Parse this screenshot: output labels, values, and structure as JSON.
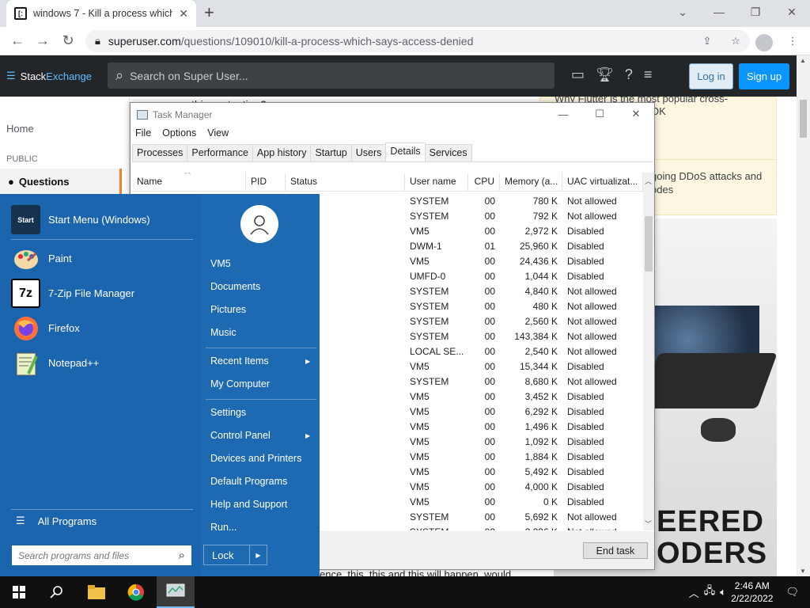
{
  "browser": {
    "tab_title": "windows 7 - Kill a process which",
    "url_host": "superuser.com",
    "url_path": "/questions/109010/kill-a-process-which-says-access-denied"
  },
  "se": {
    "logo_a": "Stack",
    "logo_b": "Exchange",
    "search_placeholder": "Search on Super User...",
    "login": "Log in",
    "signup": "Sign up",
    "nav_home": "Home",
    "nav_public": "PUBLIC",
    "nav_questions": "Questions",
    "text_top": "this protection?",
    "text_bottom": "ence, this, this and this will happen, would",
    "sidebar_r1": "Why Flutter is the most popular cross-",
    "sidebar_r2": "OK",
    "sidebar_r3": "going DDoS attacks and\nodes",
    "ad_line1": "EERED",
    "ad_line2": "ODERS"
  },
  "taskmanager": {
    "title": "Task Manager",
    "menu": [
      "File",
      "Options",
      "View"
    ],
    "tabs": [
      "Processes",
      "Performance",
      "App history",
      "Startup",
      "Users",
      "Details",
      "Services"
    ],
    "active_tab": "Details",
    "columns": [
      "Name",
      "PID",
      "Status",
      "User name",
      "CPU",
      "Memory (a...",
      "UAC virtualizat..."
    ],
    "rows": [
      {
        "status": "g",
        "user": "SYSTEM",
        "cpu": "00",
        "mem": "780 K",
        "uac": "Not allowed"
      },
      {
        "status": "g",
        "user": "SYSTEM",
        "cpu": "00",
        "mem": "792 K",
        "uac": "Not allowed"
      },
      {
        "status": "g",
        "user": "VM5",
        "cpu": "00",
        "mem": "2,972 K",
        "uac": "Disabled"
      },
      {
        "status": "g",
        "user": "DWM-1",
        "cpu": "01",
        "mem": "25,960 K",
        "uac": "Disabled"
      },
      {
        "status": "g",
        "user": "VM5",
        "cpu": "00",
        "mem": "24,436 K",
        "uac": "Disabled"
      },
      {
        "status": "g",
        "user": "UMFD-0",
        "cpu": "00",
        "mem": "1,044 K",
        "uac": "Disabled"
      },
      {
        "status": "g",
        "user": "SYSTEM",
        "cpu": "00",
        "mem": "4,840 K",
        "uac": "Not allowed"
      },
      {
        "status": "g",
        "user": "SYSTEM",
        "cpu": "00",
        "mem": "480 K",
        "uac": "Not allowed"
      },
      {
        "status": "g",
        "user": "SYSTEM",
        "cpu": "00",
        "mem": "2,560 K",
        "uac": "Not allowed"
      },
      {
        "status": "g",
        "user": "SYSTEM",
        "cpu": "00",
        "mem": "143,384 K",
        "uac": "Not allowed"
      },
      {
        "status": "g",
        "user": "LOCAL SE...",
        "cpu": "00",
        "mem": "2,540 K",
        "uac": "Not allowed"
      },
      {
        "status": "g",
        "user": "VM5",
        "cpu": "00",
        "mem": "15,344 K",
        "uac": "Disabled"
      },
      {
        "status": "g",
        "user": "SYSTEM",
        "cpu": "00",
        "mem": "8,680 K",
        "uac": "Not allowed"
      },
      {
        "status": "g",
        "user": "VM5",
        "cpu": "00",
        "mem": "3,452 K",
        "uac": "Disabled"
      },
      {
        "status": "g",
        "user": "VM5",
        "cpu": "00",
        "mem": "6,292 K",
        "uac": "Disabled"
      },
      {
        "status": "g",
        "user": "VM5",
        "cpu": "00",
        "mem": "1,496 K",
        "uac": "Disabled"
      },
      {
        "status": "g",
        "user": "VM5",
        "cpu": "00",
        "mem": "1,092 K",
        "uac": "Disabled"
      },
      {
        "status": "g",
        "user": "VM5",
        "cpu": "00",
        "mem": "1,884 K",
        "uac": "Disabled"
      },
      {
        "status": "g",
        "user": "VM5",
        "cpu": "00",
        "mem": "5,492 K",
        "uac": "Disabled"
      },
      {
        "status": "g",
        "user": "VM5",
        "cpu": "00",
        "mem": "4,000 K",
        "uac": "Disabled"
      },
      {
        "status": "ded",
        "user": "VM5",
        "cpu": "00",
        "mem": "0 K",
        "uac": "Disabled"
      },
      {
        "status": "g",
        "user": "SYSTEM",
        "cpu": "00",
        "mem": "5,692 K",
        "uac": "Not allowed"
      },
      {
        "status": "g",
        "user": "SYSTEM",
        "cpu": "00",
        "mem": "2,236 K",
        "uac": "Not allowed"
      }
    ],
    "end_task": "End task"
  },
  "startmenu": {
    "programs": [
      {
        "label": "Start Menu (Windows)",
        "icon": "start-menu-icon",
        "icon_text": "Start"
      },
      {
        "label": "Paint",
        "icon": "paint-icon",
        "icon_text": ""
      },
      {
        "label": "7-Zip File Manager",
        "icon": "7zip-icon",
        "icon_text": "7z"
      },
      {
        "label": "Firefox",
        "icon": "firefox-icon",
        "icon_text": ""
      },
      {
        "label": "Notepad++",
        "icon": "notepadpp-icon",
        "icon_text": ""
      }
    ],
    "all_programs": "All Programs",
    "search_placeholder": "Search programs and files",
    "user": "VM5",
    "links": [
      "Documents",
      "Pictures",
      "Music",
      "Recent Items",
      "My Computer",
      "Settings",
      "Control Panel",
      "Devices and Printers",
      "Default Programs",
      "Help and Support",
      "Run..."
    ],
    "lock": "Lock"
  },
  "taskbar": {
    "time": "2:46 AM",
    "date": "2/22/2022"
  },
  "colors": {
    "start_menu": "#1e6ab2",
    "se_header": "#232629",
    "se_accent": "#f48225",
    "signup": "#0a95ff"
  }
}
